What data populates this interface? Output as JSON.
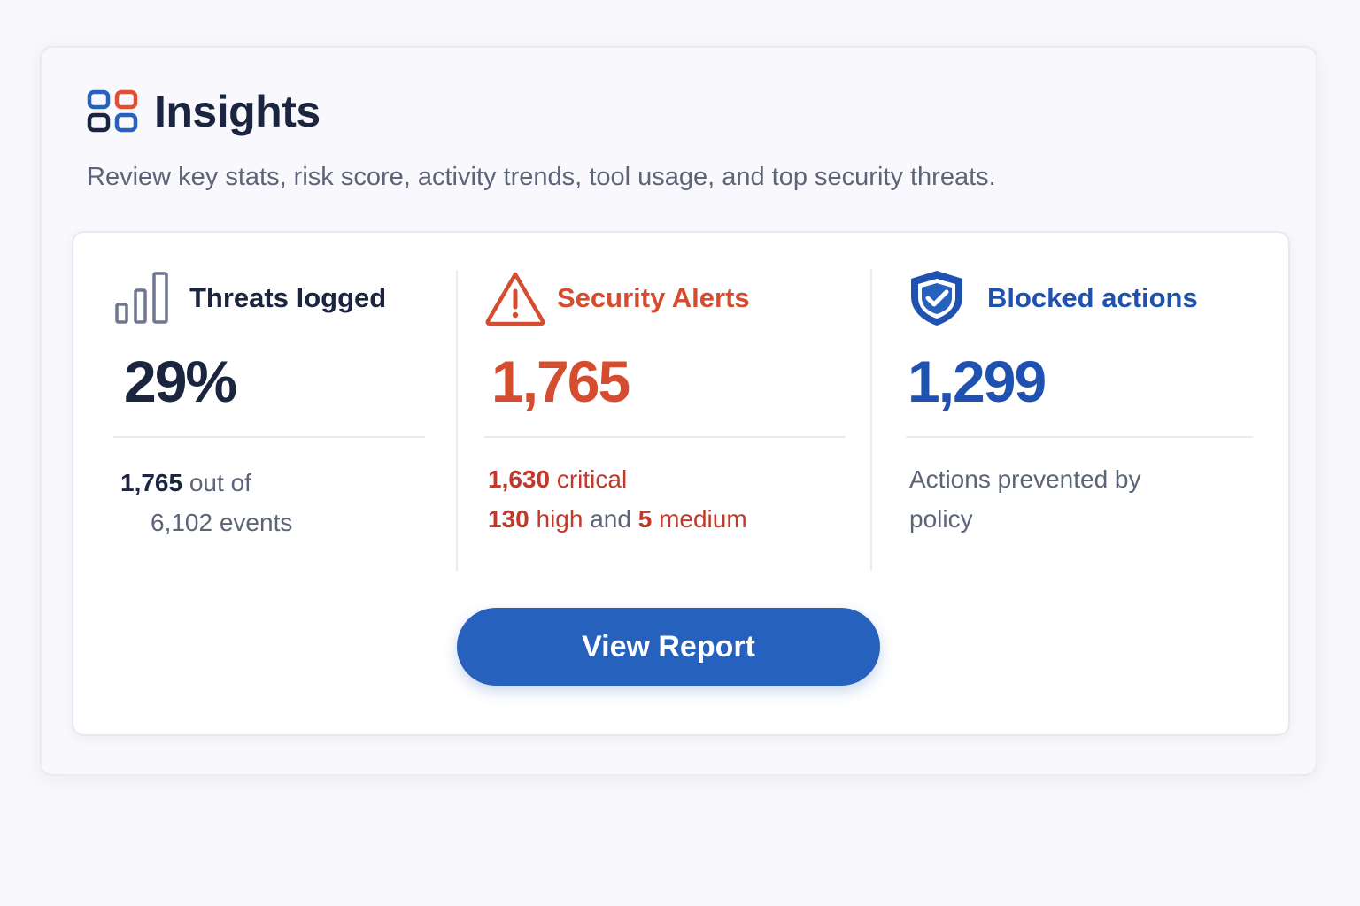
{
  "panel": {
    "title": "Insights",
    "icon": "apps-grid-icon",
    "subtitle": "Review key stats, risk score, activity trends, tool usage, and top security threats."
  },
  "stats": {
    "threats": {
      "icon": "bar-chart-icon",
      "label": "Threats logged",
      "value": "29%",
      "detail_count": "1,765",
      "detail_mid": "out of",
      "detail_total": "6,102 events"
    },
    "alerts": {
      "icon": "warning-triangle-icon",
      "label": "Security Alerts",
      "value": "1,765",
      "critical_count": "1,630",
      "critical_label": "critical",
      "high_count": "130",
      "high_label": "high",
      "and_label": "and",
      "medium_count": "5",
      "medium_label": "medium"
    },
    "blocked": {
      "icon": "shield-check-icon",
      "label": "Blocked actions",
      "value": "1,299",
      "detail": "Actions prevented by policy"
    }
  },
  "actions": {
    "view_report_label": "View Report"
  },
  "colors": {
    "dark": "#1b2540",
    "alert_red": "#d44d2e",
    "brand_blue": "#2561bd",
    "muted_text": "#5c6478"
  }
}
